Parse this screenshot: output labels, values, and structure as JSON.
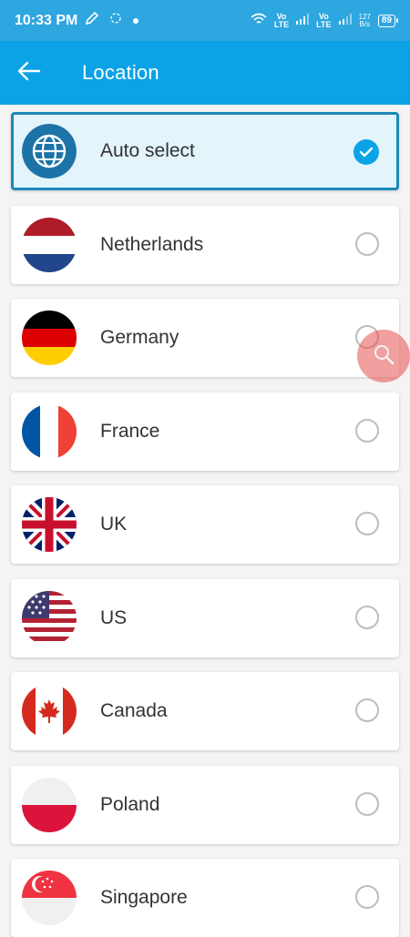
{
  "status_bar": {
    "time": "10:33 PM",
    "net1_top": "Vo",
    "net1_bottom": "LTE",
    "net2_top": "Vo",
    "net2_bottom": "LTE",
    "speed_value": "127",
    "speed_unit": "B/s",
    "battery": "89"
  },
  "header": {
    "title": "Location"
  },
  "locations": [
    {
      "label": "Auto select",
      "flag": "globe-icon",
      "selected": true
    },
    {
      "label": "Netherlands",
      "flag": "netherlands-flag",
      "selected": false
    },
    {
      "label": "Germany",
      "flag": "germany-flag",
      "selected": false
    },
    {
      "label": "France",
      "flag": "france-flag",
      "selected": false
    },
    {
      "label": "UK",
      "flag": "uk-flag",
      "selected": false
    },
    {
      "label": "US",
      "flag": "us-flag",
      "selected": false
    },
    {
      "label": "Canada",
      "flag": "canada-flag",
      "selected": false
    },
    {
      "label": "Poland",
      "flag": "poland-flag",
      "selected": false
    },
    {
      "label": "Singapore",
      "flag": "singapore-flag",
      "selected": false
    }
  ],
  "colors": {
    "status_bar": "#2ea6e0",
    "app_bar": "#0ba3e6",
    "selected_border": "#1c88b8",
    "selected_bg": "#e3f4fb",
    "check": "#0ba3e6"
  }
}
